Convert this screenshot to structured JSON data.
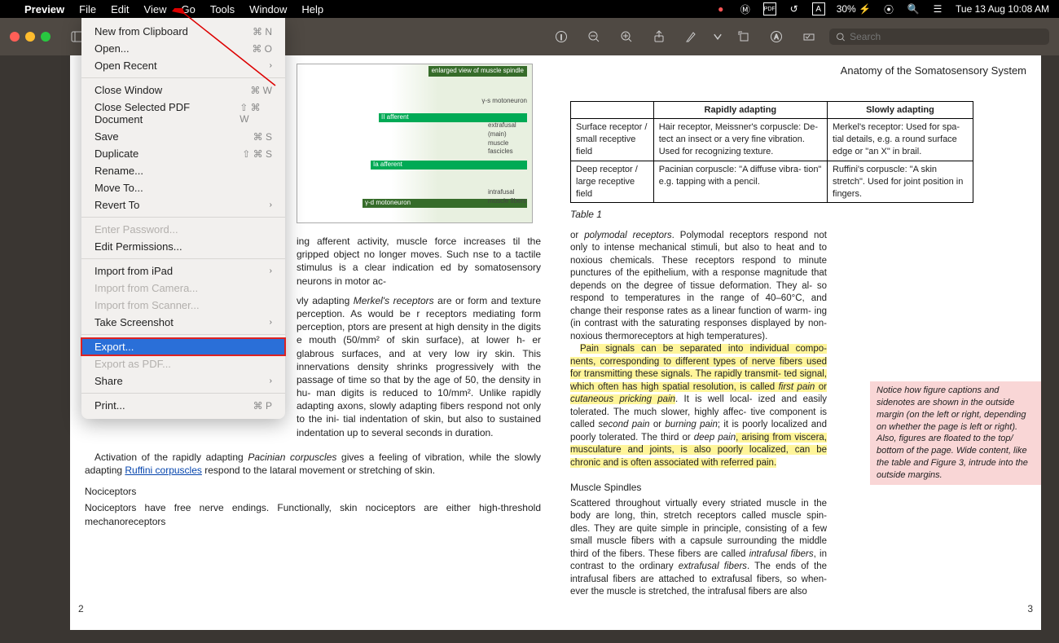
{
  "menubar": {
    "app": "Preview",
    "items": [
      "File",
      "Edit",
      "View",
      "Go",
      "Tools",
      "Window",
      "Help"
    ],
    "right": {
      "battery": "30%",
      "datetime": "Tue 13 Aug  10:08 AM",
      "lang": "A",
      "pdf": "PDF"
    }
  },
  "toolbar": {
    "search_placeholder": "Search"
  },
  "file_menu": {
    "groups": [
      [
        {
          "label": "New from Clipboard",
          "sc": "⌘ N"
        },
        {
          "label": "Open...",
          "sc": "⌘ O"
        },
        {
          "label": "Open Recent",
          "sub": true
        }
      ],
      [
        {
          "label": "Close Window",
          "sc": "⌘ W"
        },
        {
          "label": "Close Selected PDF Document",
          "sc": "⇧ ⌘ W"
        },
        {
          "label": "Save",
          "sc": "⌘ S"
        },
        {
          "label": "Duplicate",
          "sc": "⇧ ⌘ S"
        },
        {
          "label": "Rename..."
        },
        {
          "label": "Move To..."
        },
        {
          "label": "Revert To",
          "sub": true
        }
      ],
      [
        {
          "label": "Enter Password...",
          "disabled": true
        },
        {
          "label": "Edit Permissions..."
        }
      ],
      [
        {
          "label": "Import from iPad",
          "sub": true
        },
        {
          "label": "Import from Camera...",
          "disabled": true
        },
        {
          "label": "Import from Scanner...",
          "disabled": true
        },
        {
          "label": "Take Screenshot",
          "sub": true
        }
      ],
      [
        {
          "label": "Export...",
          "selected": true
        },
        {
          "label": "Export as PDF...",
          "disabled": true
        },
        {
          "label": "Share",
          "sub": true
        }
      ],
      [
        {
          "label": "Print...",
          "sc": "⌘ P"
        }
      ]
    ]
  },
  "doc": {
    "header_right": "Anatomy of the Somatosensory System",
    "page_left_num": "2",
    "page_right_num": "3",
    "fig_caption": "enlarged view of muscle spindle",
    "fig_labels": [
      "γ-s motoneuron",
      "II afferent",
      "Ia afferent",
      "γ-d motoneuron",
      "extrafusal (main) muscle fascicles",
      "intrafusal muscle fibers"
    ],
    "left_body": "ing afferent activity, muscle force increases til the gripped object no longer moves. Such nse to a tactile stimulus is a clear indication ed by somatosensory neurons in motor ac-",
    "left_p2a": "vly adapting ",
    "left_p2_merkel": "Merkel's receptors",
    "left_p2b": " are or form and texture perception. As would be r receptors mediating form perception, ptors are present at high density in the digits e mouth (50/mm² of skin surface), at lower h- er glabrous surfaces, and at very low iry skin. This innervations density shrinks progressively with the passage of time so that by the age of 50, the density in hu- man digits is reduced to 10/mm². Unlike rapidly adapting axons, slowly adapting fibers respond not only to the ini- tial indentation of skin, but also to sustained indentation up to several seconds in duration.",
    "left_p3a": "Activation of the rapidly adapting ",
    "left_p3_pac": "Pacinian corpuscles",
    "left_p3b": " gives a feeling of vibration, while the slowly adapting ",
    "left_p3_link": "Ruffini corpuscles",
    "left_p3c": " respond to the lataral movement or stretching of skin.",
    "left_h1": "Nociceptors",
    "left_p4": "Nociceptors have free nerve endings. Functionally, skin nociceptors are either high-threshold mechanoreceptors",
    "table": {
      "head": [
        "",
        "Rapidly adapting",
        "Slowly adapting"
      ],
      "rows": [
        [
          "Surface receptor / small receptive field",
          "Hair receptor, Meissner's corpuscle: De- tect an insect or a very fine vibration. Used for recognizing texture.",
          "Merkel's receptor: Used for spa- tial details, e.g. a round surface edge or \"an X\" in brail."
        ],
        [
          "Deep receptor / large receptive field",
          "Pacinian corpuscle: \"A diffuse vibra- tion\" e.g. tapping with a pencil.",
          "Ruffini's corpuscle: \"A skin stretch\". Used for joint position in fingers."
        ]
      ],
      "caption": "Table 1"
    },
    "right_p1a": "or ",
    "right_p1_poly": "polymodal receptors",
    "right_p1b": ". Polymodal receptors respond not only to intense mechanical stimuli, but also to heat and to noxious chemicals. These receptors respond to minute punctures of the epithelium, with a response magnitude that depends on the degree of tissue deformation. They al- so respond to temperatures in the range of 40–60°C, and change their response rates as a linear function of warm- ing (in contrast with the saturating responses displayed by non-noxious thermoreceptors at high temperatures).",
    "right_hl1": "Pain signals can be separated into individual compo- nents, corresponding to different types of nerve fibers used for transmitting these signals. The rapidly transmit- ted signal, which often has high spatial resolution, is called ",
    "right_hl1b": "first pain",
    "right_hl1c": " or ",
    "right_hl1d": "cutaneous pricking pain",
    "right_hl1e": ". It is well local- ized and easily tolerated. The much slower, highly affec- tive component is called ",
    "right_hl1f": "second pain",
    "right_hl1g": " or ",
    "right_hl1h": "burning pain",
    "right_hl1i": "; it is poorly localized and poorly tolerated. The third or ",
    "right_hl1j": "deep pain",
    "right_hl1k": ", arising from viscera, musculature and joints, is also poorly localized, can be chronic and is often associated with referred pain.",
    "right_h1": "Muscle Spindles",
    "right_p2a": "Scattered throughout virtually every striated muscle in the body are long, thin, stretch receptors called muscle spin- dles. They are quite simple in principle, consisting of a few small muscle fibers with a capsule surrounding the middle third of the fibers. These fibers are called ",
    "right_p2b": "intrafusal fibers",
    "right_p2c": ", in contrast to the ordinary ",
    "right_p2d": "extrafusal fibers",
    "right_p2e": ". The ends of the intrafusal fibers are attached to extrafusal fibers, so when- ever the muscle is stretched, the intrafusal fibers are also",
    "sidenote": "Notice how figure captions and sidenotes are shown in the outside margin (on the left or right, depending on whether the page is left or right). Also, figures are floated to the top/ bottom of the page. Wide content, like the table and Figure 3, intrude into the outside margins."
  }
}
